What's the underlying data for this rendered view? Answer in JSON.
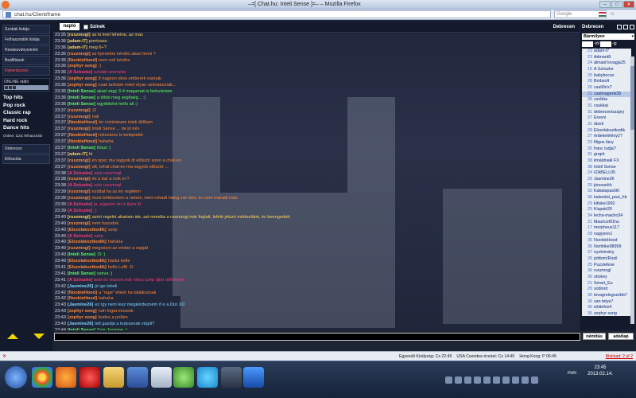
{
  "window": {
    "title": "–=[ Chat.hu: Inteli Sense ]=– – Mozilla Firefox",
    "url": "chat.hu/Client/frame",
    "search_placeholder": "Google"
  },
  "left_menu": [
    {
      "label": "Szobák listája",
      "red": false
    },
    {
      "label": "Felhasználók listája",
      "red": false
    },
    {
      "label": "Rendezvényeimért",
      "red": false
    },
    {
      "label": "Beállítások",
      "red": false
    },
    {
      "label": "Kijelentkezés",
      "red": true
    }
  ],
  "radio": {
    "title": "ONLINE rádió",
    "genres": [
      "Top hits",
      "Pop rock",
      "Classic rap",
      "Hard rock",
      "Dance hits"
    ],
    "listeners": "Online: 1101 felhasználó"
  },
  "rooms": [
    {
      "label": "Debrecen"
    },
    {
      "label": "Előszoba"
    }
  ],
  "chat": {
    "tab": "napló",
    "checkbox_label": "Színek",
    "room": "Debrecen",
    "messages": [
      {
        "t": "23:35",
        "n": "[ruszmogl]",
        "x": "az ki ével lehetne, az mas",
        "c": "#ffd35a"
      },
      {
        "t": "23:36",
        "n": "[adam-l7]",
        "x": "pontosan",
        "c": "#ffd35a"
      },
      {
        "t": "23:36",
        "n": "[adam-l7]",
        "x": "meg 6+?",
        "c": "#ffd35a"
      },
      {
        "t": "23:36",
        "n": "[ruszmogl]",
        "x": "az ilyenekre kérdés akart lenni ?",
        "c": "#ff8a3a"
      },
      {
        "t": "23:36",
        "n": "[NoobieHood]",
        "x": "nem volt kérdés",
        "c": "#ff8a3a"
      },
      {
        "t": "23:36",
        "n": "[zephyr song]",
        "x": ":)",
        "c": "#ff8a3a"
      },
      {
        "t": "23:36",
        "n": "[A Szöszke]",
        "x": "szódát szemeke",
        "c": "#ff3c7a"
      },
      {
        "t": "23:36",
        "n": "[zephyr song]",
        "x": "ő nagyon okos emberek vannak",
        "c": "#ff8a3a"
      },
      {
        "t": "23:36",
        "n": "[zephyr song]",
        "x": "csak tudnám miért olyan szimatoznak...",
        "c": "#ff8a3a"
      },
      {
        "t": "23:36",
        "n": "[Inteli Sense]",
        "x": "akad vagy 3-4 magamat is belezártam",
        "c": "#5dff5d"
      },
      {
        "t": "23:36",
        "n": "[Inteli Sense]",
        "x": "a többi meg segítség... :)",
        "c": "#5dff5d"
      },
      {
        "t": "23:36",
        "n": "[Inteli Sense]",
        "x": "egyébként hello all :)",
        "c": "#5dff5d"
      },
      {
        "t": "23:37",
        "n": "[ruszmogl]",
        "x": ":D",
        "c": "#ff8a3a"
      },
      {
        "t": "23:37",
        "n": "[ruszmogl]",
        "x": "hali",
        "c": "#ff8a3a"
      },
      {
        "t": "23:37",
        "n": "[NoobieHood]",
        "x": "én cíztéránem inteli állíltam",
        "c": "#ff8a3a"
      },
      {
        "t": "23:37",
        "n": "[ruszmogl]",
        "x": "Inteli Sense ... de jó név",
        "c": "#ff8a3a"
      },
      {
        "t": "23:37",
        "n": "[NoobieHood]",
        "x": "mészáros is beléptetté",
        "c": "#ff8a3a"
      },
      {
        "t": "23:37",
        "n": "[NoobieHood]",
        "x": "hahaha",
        "c": "#ff8a3a"
      },
      {
        "t": "23:37",
        "n": "[Inteli Sense]",
        "x": "köszi :)",
        "c": "#5dff5d"
      },
      {
        "t": "23:37",
        "n": "[adam-l7]",
        "x": "hi",
        "c": "#ffd35a"
      },
      {
        "t": "23:37",
        "n": "[ruszmogl]",
        "x": "én spec ma vagyok itt először ezen a chat-en",
        "c": "#ff8a3a"
      },
      {
        "t": "23:37",
        "n": "[ruszmogl]",
        "x": "ott, tehát chat-en ma vagyok először ...",
        "c": "#ff8a3a"
      },
      {
        "t": "23:38",
        "n": "[A Szöszke]",
        "x": "szia ruszmogl",
        "c": "#ff3c7a"
      },
      {
        "t": "23:38",
        "n": "[ruszmogl]",
        "x": "és a bar a ncik el ?",
        "c": "#ff8a3a"
      },
      {
        "t": "23:38",
        "n": "[A Szöszke]",
        "x": "szia ruszmogl",
        "c": "#ff3c7a"
      },
      {
        "t": "23:39",
        "n": "[ruszmogl]",
        "x": "ezúttal ha az én regélem",
        "c": "#ff8a3a"
      },
      {
        "t": "23:39",
        "n": "[ruszmogl]",
        "x": "most bökkentem a netem, mert rohadt hideg van kint, és nem maradt más",
        "c": "#ff8a3a"
      },
      {
        "t": "23:39",
        "n": "[A Szöszke]",
        "x": "ja, egyszer mi is ilyen itt",
        "c": "#ff3c7a"
      },
      {
        "t": "23:39",
        "n": "[A Szöszke]",
        "x": ":)",
        "c": "#ff3c7a"
      },
      {
        "t": "23:40",
        "n": "[ruszmogl]",
        "x": "azért regelni akartam ide, azt mondta a ruszmogl már foglalt, lefelé jelszó módosítást, és beengedett",
        "c": "#ffd35a"
      },
      {
        "t": "23:40",
        "n": "[ruszmogl]",
        "x": "nem hazudok",
        "c": "#ff8a3a"
      },
      {
        "t": "23:40",
        "n": "[Elszolakoztkodik]",
        "x": "szép",
        "c": "#ff8a3a"
      },
      {
        "t": "23:40",
        "n": "[A Szöszke]",
        "x": "szép",
        "c": "#ff3c7a"
      },
      {
        "t": "23:40",
        "n": "[Elszolakoztkodik]",
        "x": "hahaha",
        "c": "#ff8a3a"
      },
      {
        "t": "23:40",
        "n": "[ruszmogl]",
        "x": "megnézni az ember a napját",
        "c": "#ff8a3a"
      },
      {
        "t": "23:40",
        "n": "[Inteli Sense]",
        "x": ":D :)",
        "c": "#5dff5d"
      },
      {
        "t": "23:40",
        "n": "[Elszolakoztkodik]",
        "x": "haslui kelle",
        "c": "#ff8a3a"
      },
      {
        "t": "23:41",
        "n": "[Elszolakoztkodik]",
        "x": "hello LoBi :D",
        "c": "#ff8a3a"
      },
      {
        "t": "23:41",
        "n": "[Inteli Sense]",
        "x": "szeva :)",
        "c": "#5dff5d"
      },
      {
        "t": "23:41",
        "n": "[A Szöszke]",
        "x": "bokl és viszont már nincs szép újhó ülőhelyen",
        "c": "#ff3c7a"
      },
      {
        "t": "23:42",
        "n": "[Jasmine26]",
        "x": "jó ige lebeli",
        "c": "#7fd4ff"
      },
      {
        "t": "23:42",
        "n": "[NoobieHood]",
        "x": "a \"rage\" érkek ha találkoznak",
        "c": "#ff8a3a"
      },
      {
        "t": "23:42",
        "n": "[NoobieHood]",
        "x": "hahaha",
        "c": "#ff8a3a"
      },
      {
        "t": "23:43",
        "n": "[Jasmine26]",
        "x": "ez így nem lesz megkérdezném ő e a Dizi XD",
        "c": "#7fd4ff"
      },
      {
        "t": "23:43",
        "n": "[zephyr song]",
        "x": "nah fogat mossok",
        "c": "#ff8a3a"
      },
      {
        "t": "23:43",
        "n": "[zephyr song]",
        "x": "budos a pofám",
        "c": "#ff8a3a"
      },
      {
        "t": "23:43",
        "n": "[Jasmine26]",
        "x": "lett gazdja a kutyusnak végül?",
        "c": "#7fd4ff"
      },
      {
        "t": "23:44",
        "n": "[Inteli Sense]",
        "x": "Szia Jasmine :)",
        "c": "#5dff5d"
      },
      {
        "t": "23:45",
        "n": "[A Szöszke]",
        "x": "http://www.facebook.com/photo.php?fbid=... csak a lélek legyen örök",
        "c": "#ff3c7a"
      }
    ]
  },
  "right_panel": {
    "city": "Debrecen",
    "filter_value": "Bármilyen",
    "age_from_label": "-tól",
    "age_to_label": "-ig",
    "users": [
      {
        "age": "23",
        "name": "adam-l7"
      },
      {
        "age": "23",
        "name": "Admant8"
      },
      {
        "age": "24",
        "name": "álmaid lovagja25"
      },
      {
        "age": "15",
        "name": "A Szöszke"
      },
      {
        "age": "25",
        "name": "babybocso"
      },
      {
        "age": "28",
        "name": "Bmbsolt"
      },
      {
        "age": "26",
        "name": "castl0r/x7"
      },
      {
        "age": "21",
        "name": "csalmagenk35"
      },
      {
        "age": "36",
        "name": "csobba"
      },
      {
        "age": "31",
        "name": "csukkat"
      },
      {
        "age": "31",
        "name": "debreceniszajny"
      },
      {
        "age": "27",
        "name": "Ereeni"
      },
      {
        "age": "31",
        "name": "dizeli"
      },
      {
        "age": "28",
        "name": "Elszolakoztkodik"
      },
      {
        "age": "27",
        "name": "érdekelélény27"
      },
      {
        "age": "23",
        "name": "filigos lány"
      },
      {
        "age": "35",
        "name": "franc tudja?"
      },
      {
        "age": "31",
        "name": "graph"
      },
      {
        "age": "38",
        "name": "ilmáldnaik FX"
      },
      {
        "age": "38",
        "name": "Inteli Sense"
      },
      {
        "age": "24",
        "name": "IZABELL05"
      },
      {
        "age": "26",
        "name": "Jasmine26"
      },
      {
        "age": "29",
        "name": "jónossötö"
      },
      {
        "age": "32",
        "name": "Kabalapasi90"
      },
      {
        "age": "36",
        "name": "kalandot_pasi_hb"
      },
      {
        "age": "29",
        "name": "kitiske1992"
      },
      {
        "age": "25",
        "name": "Kispaki25"
      },
      {
        "age": "34",
        "name": "lecho-macho34"
      },
      {
        "age": "21",
        "name": "Mauricel91hu"
      },
      {
        "age": "17",
        "name": "morpheus117"
      },
      {
        "age": "28",
        "name": "nagyeon1"
      },
      {
        "age": "36",
        "name": "NoobieHood"
      },
      {
        "age": "36",
        "name": "Northike98999"
      },
      {
        "age": "37",
        "name": "nyulomány"
      },
      {
        "age": "26",
        "name": "pöttom/Rozil"
      },
      {
        "age": "25",
        "name": "Puzzlefese"
      },
      {
        "age": "36",
        "name": "ruszmogl"
      },
      {
        "age": "36",
        "name": "shokey"
      },
      {
        "age": "21",
        "name": "Smart_Eu"
      },
      {
        "age": "29",
        "name": "soblord"
      },
      {
        "age": "36",
        "name": "tevagrelegszebb7"
      },
      {
        "age": "36",
        "name": "van tetye7"
      },
      {
        "age": "36",
        "name": "whitefox4"
      },
      {
        "age": "36",
        "name": "zephyr song"
      },
      {
        "age": "36",
        "name": "zok.7"
      }
    ],
    "mute_label": "némítás",
    "send_label": "adatlap"
  },
  "statusbar": {
    "items": [
      "Egyesült Királyság: Cs 22:45",
      "USA Csendes-óceáni: Cs 14:45",
      "Hong Kong: P 06:45"
    ],
    "blocked": "Blokkad: 2 of 2"
  },
  "taskbar": {
    "lang": "HUN",
    "time": "23:45",
    "date": "2013.02.14."
  },
  "colors": {
    "accent": "#e8742a",
    "chat_bg": "#20263c",
    "arrow": "#f0d400"
  }
}
